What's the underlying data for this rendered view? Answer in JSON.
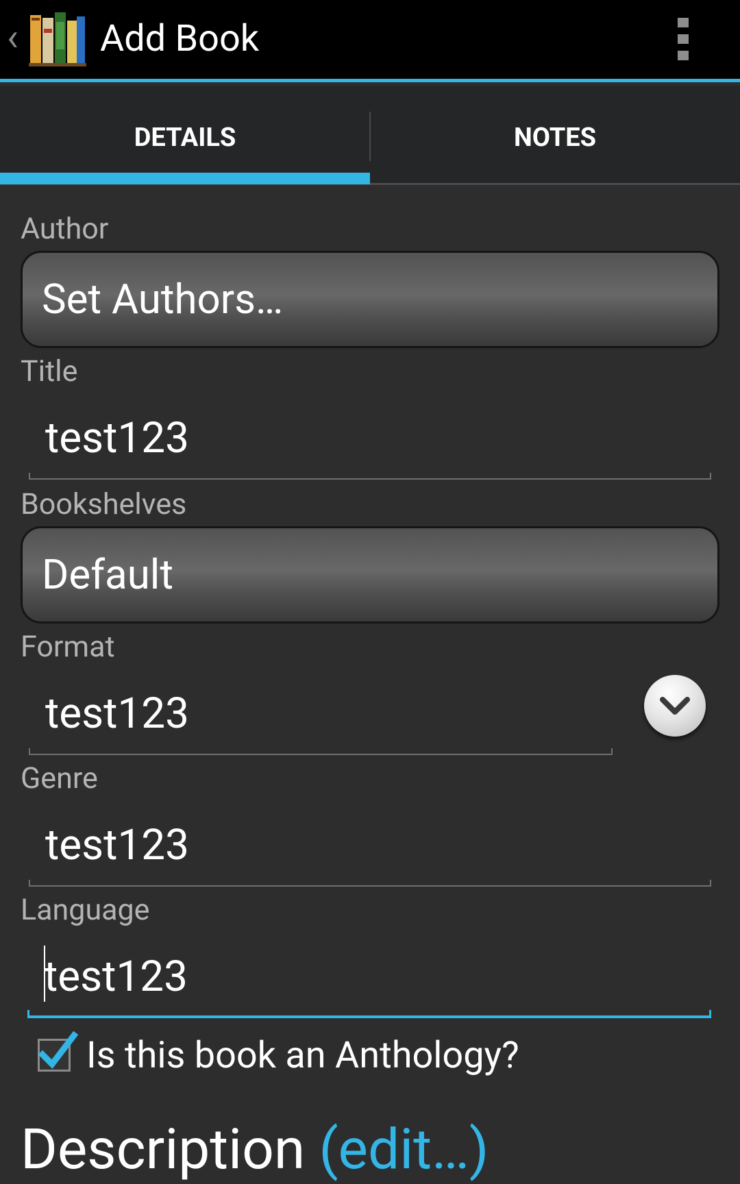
{
  "action_bar": {
    "title": "Add Book",
    "logo_icon": "bookshelf-logo-icon",
    "accent_color": "#33b5e5"
  },
  "tabs": [
    {
      "label": "DETAILS",
      "selected": true
    },
    {
      "label": "NOTES",
      "selected": false
    }
  ],
  "form": {
    "author": {
      "label": "Author",
      "button": "Set Authors…"
    },
    "title": {
      "label": "Title",
      "value": "test123"
    },
    "bookshelves": {
      "label": "Bookshelves",
      "button": "Default"
    },
    "format": {
      "label": "Format",
      "value": "test123"
    },
    "genre": {
      "label": "Genre",
      "value": "test123"
    },
    "language": {
      "label": "Language",
      "value": "test123"
    },
    "anthology": {
      "label": "Is this book an Anthology?",
      "checked": true
    },
    "description": {
      "label": "Description",
      "edit_link": "(edit…)"
    }
  }
}
